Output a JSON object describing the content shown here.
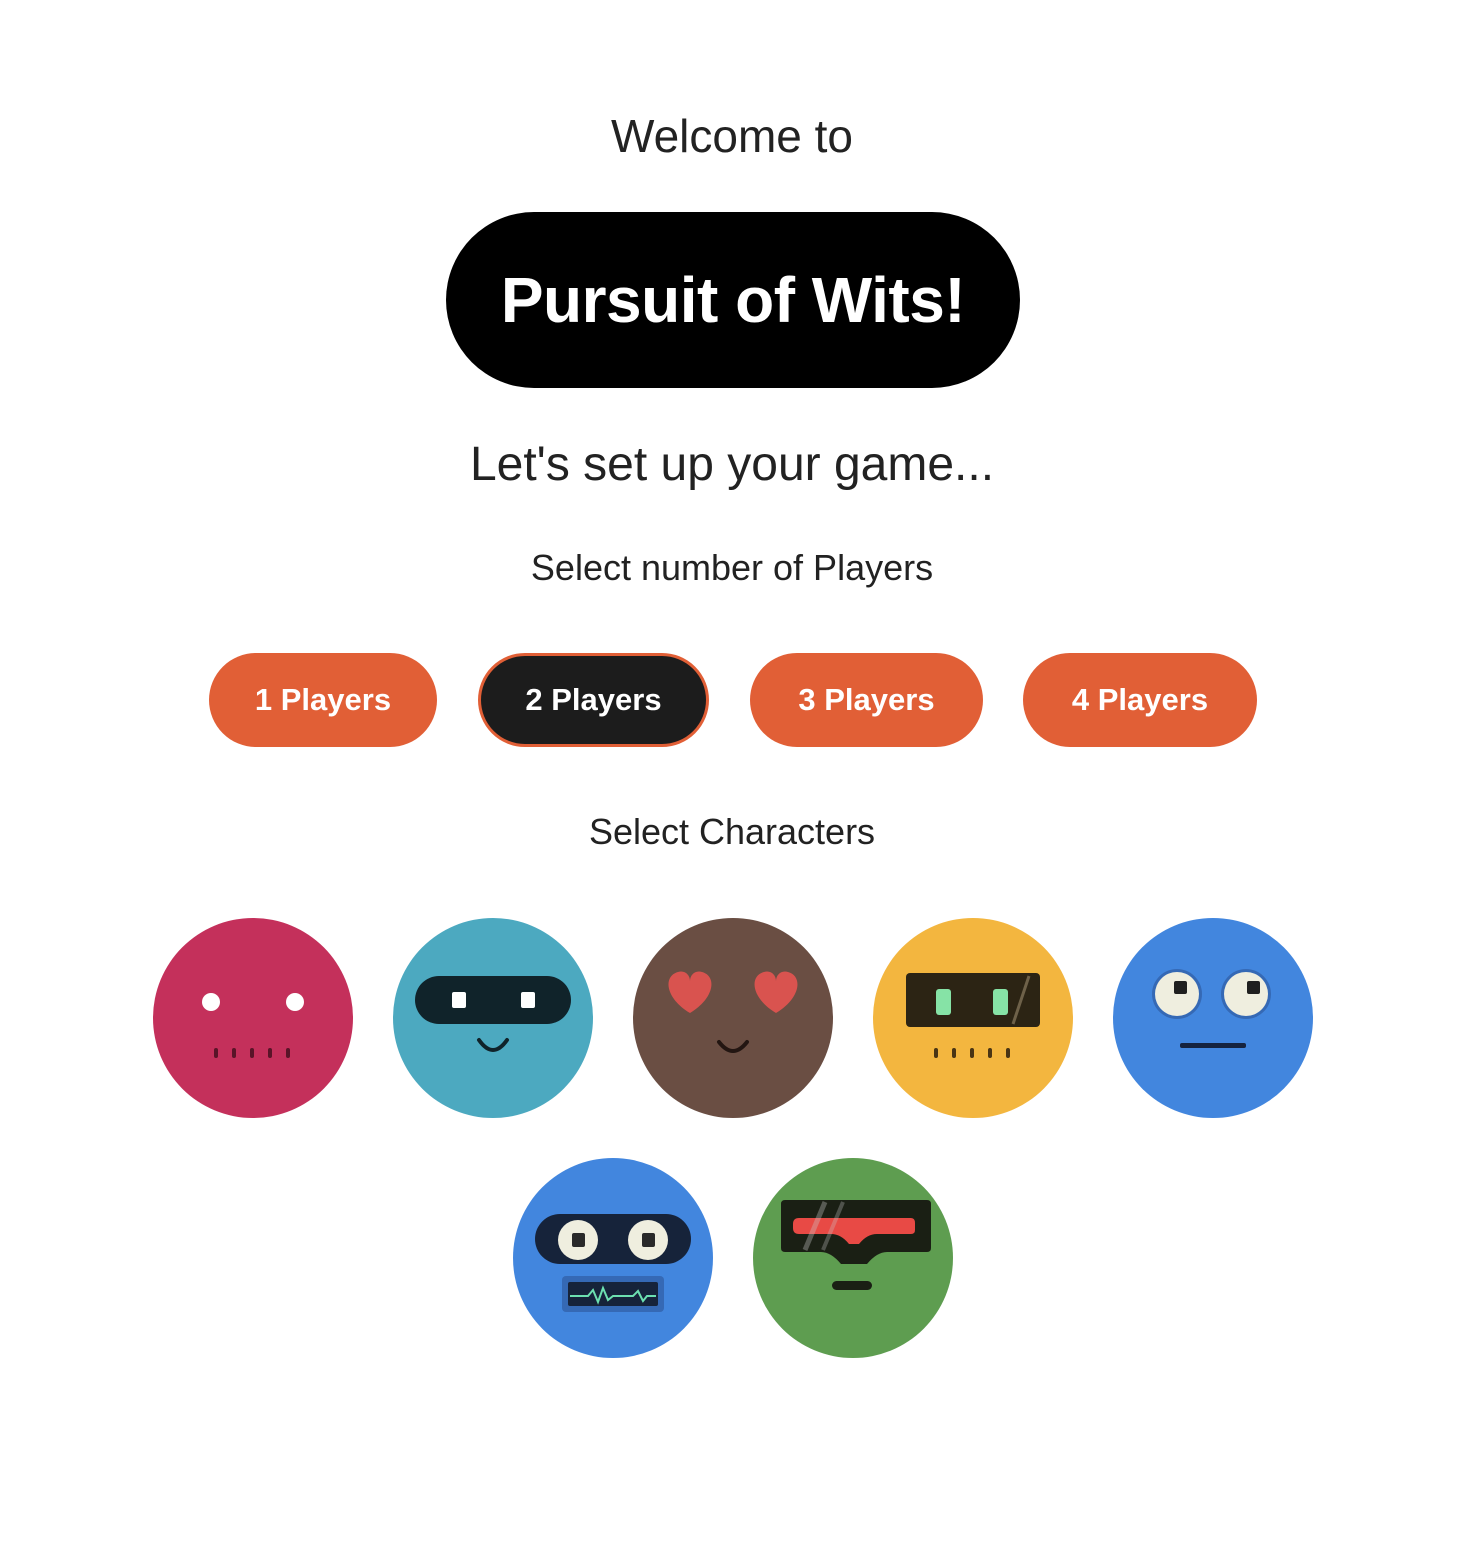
{
  "header": {
    "welcome": "Welcome to",
    "game_title": "Pursuit of Wits!",
    "subtitle": "Let's set up your game..."
  },
  "players_section": {
    "label": "Select number of Players",
    "options": [
      {
        "label": "1 Players",
        "selected": false
      },
      {
        "label": "2 Players",
        "selected": true
      },
      {
        "label": "3 Players",
        "selected": false
      },
      {
        "label": "4 Players",
        "selected": false
      }
    ],
    "accent_color": "#e15f36",
    "selected_color": "#1c1c1c"
  },
  "characters_section": {
    "label": "Select Characters",
    "characters": [
      {
        "icon": "pink-robot-face-icon",
        "color": "#c4305b"
      },
      {
        "icon": "teal-visor-robot-face-icon",
        "color": "#4ca9c0"
      },
      {
        "icon": "brown-heart-eyes-face-icon",
        "color": "#6a4e43"
      },
      {
        "icon": "yellow-screen-robot-face-icon",
        "color": "#f3b63f"
      },
      {
        "icon": "blue-googly-eyes-face-icon",
        "color": "#4286de"
      },
      {
        "icon": "blue-heartbeat-robot-face-icon",
        "color": "#4286de"
      },
      {
        "icon": "green-red-visor-face-icon",
        "color": "#5e9d50"
      }
    ]
  }
}
